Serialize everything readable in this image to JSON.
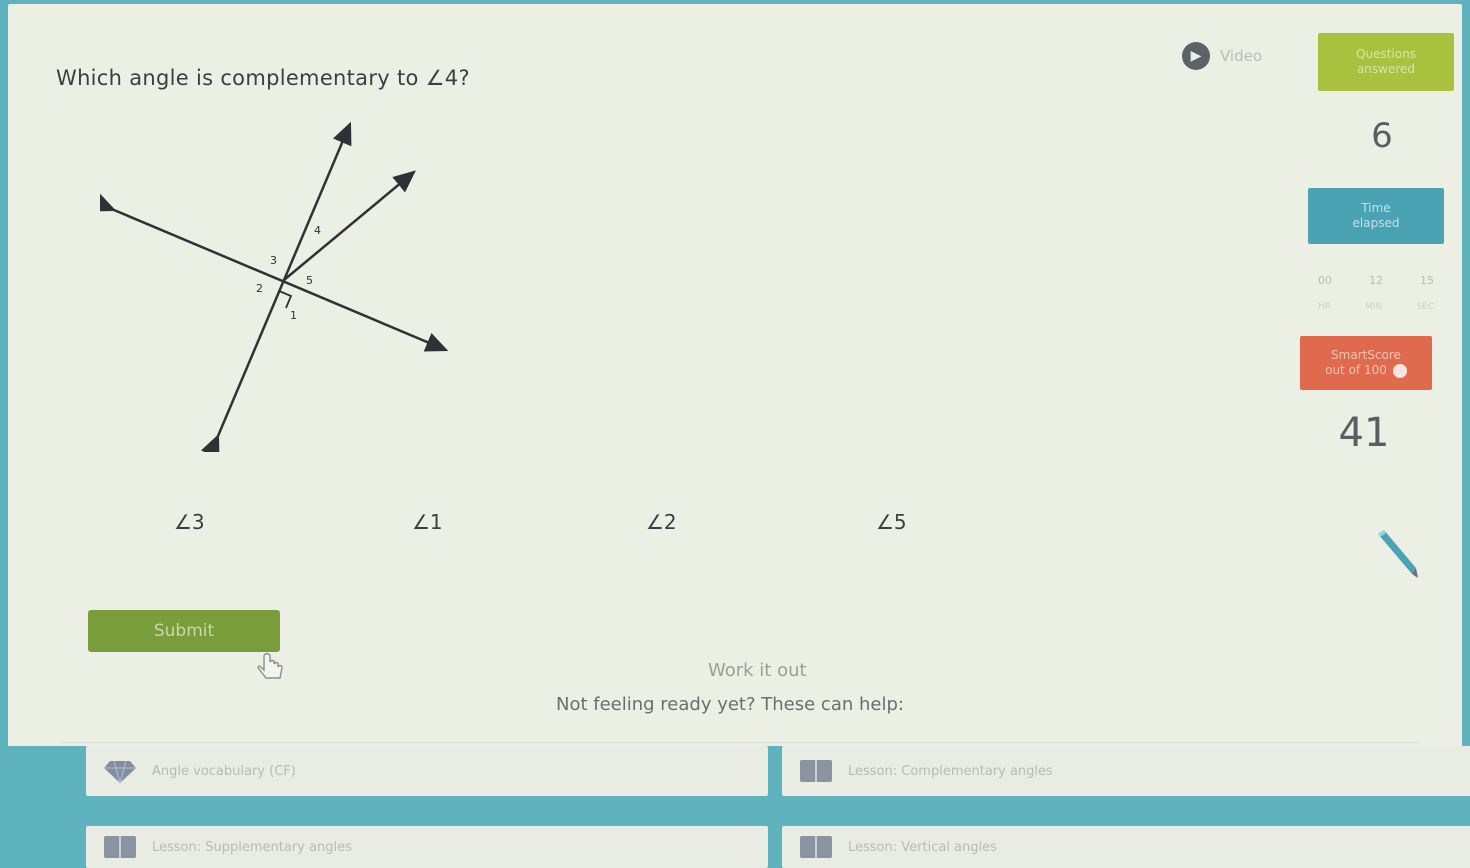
{
  "question": {
    "prefix": "Which angle is complementary to ",
    "angle": "∠4",
    "suffix": "?"
  },
  "figure": {
    "labels": {
      "a1": "1",
      "a2": "2",
      "a3": "3",
      "a4": "4",
      "a5": "5"
    }
  },
  "choices": [
    "∠3",
    "∠1",
    "∠2",
    "∠5"
  ],
  "submit_label": "Submit",
  "work_it_out": "Work it out",
  "help_text": "Not feeling ready yet? These can help:",
  "resources": [
    {
      "icon": "gem-icon",
      "label": "Angle vocabulary (CF)"
    },
    {
      "icon": "book-icon",
      "label": "Lesson: Complementary angles"
    },
    {
      "icon": "book-icon",
      "label": "Lesson: Supplementary angles"
    },
    {
      "icon": "book-icon",
      "label": "Lesson: Vertical angles"
    }
  ],
  "sidebar": {
    "video_label": "Video",
    "answered": {
      "line1": "Questions",
      "line2": "answered",
      "value": "6"
    },
    "time": {
      "line1": "Time",
      "line2": "elapsed",
      "hr": "00",
      "min": "12",
      "sec": "15",
      "hr_label": "HR",
      "min_label": "MIN",
      "sec_label": "SEC"
    },
    "score": {
      "line1": "SmartScore",
      "line2": "out of 100",
      "value": "41"
    }
  },
  "colors": {
    "answered": "#a9c13f",
    "time": "#4aa3b3",
    "score": "#e06a4e",
    "submit": "#7a9d3c",
    "frame": "#5fb3be"
  }
}
